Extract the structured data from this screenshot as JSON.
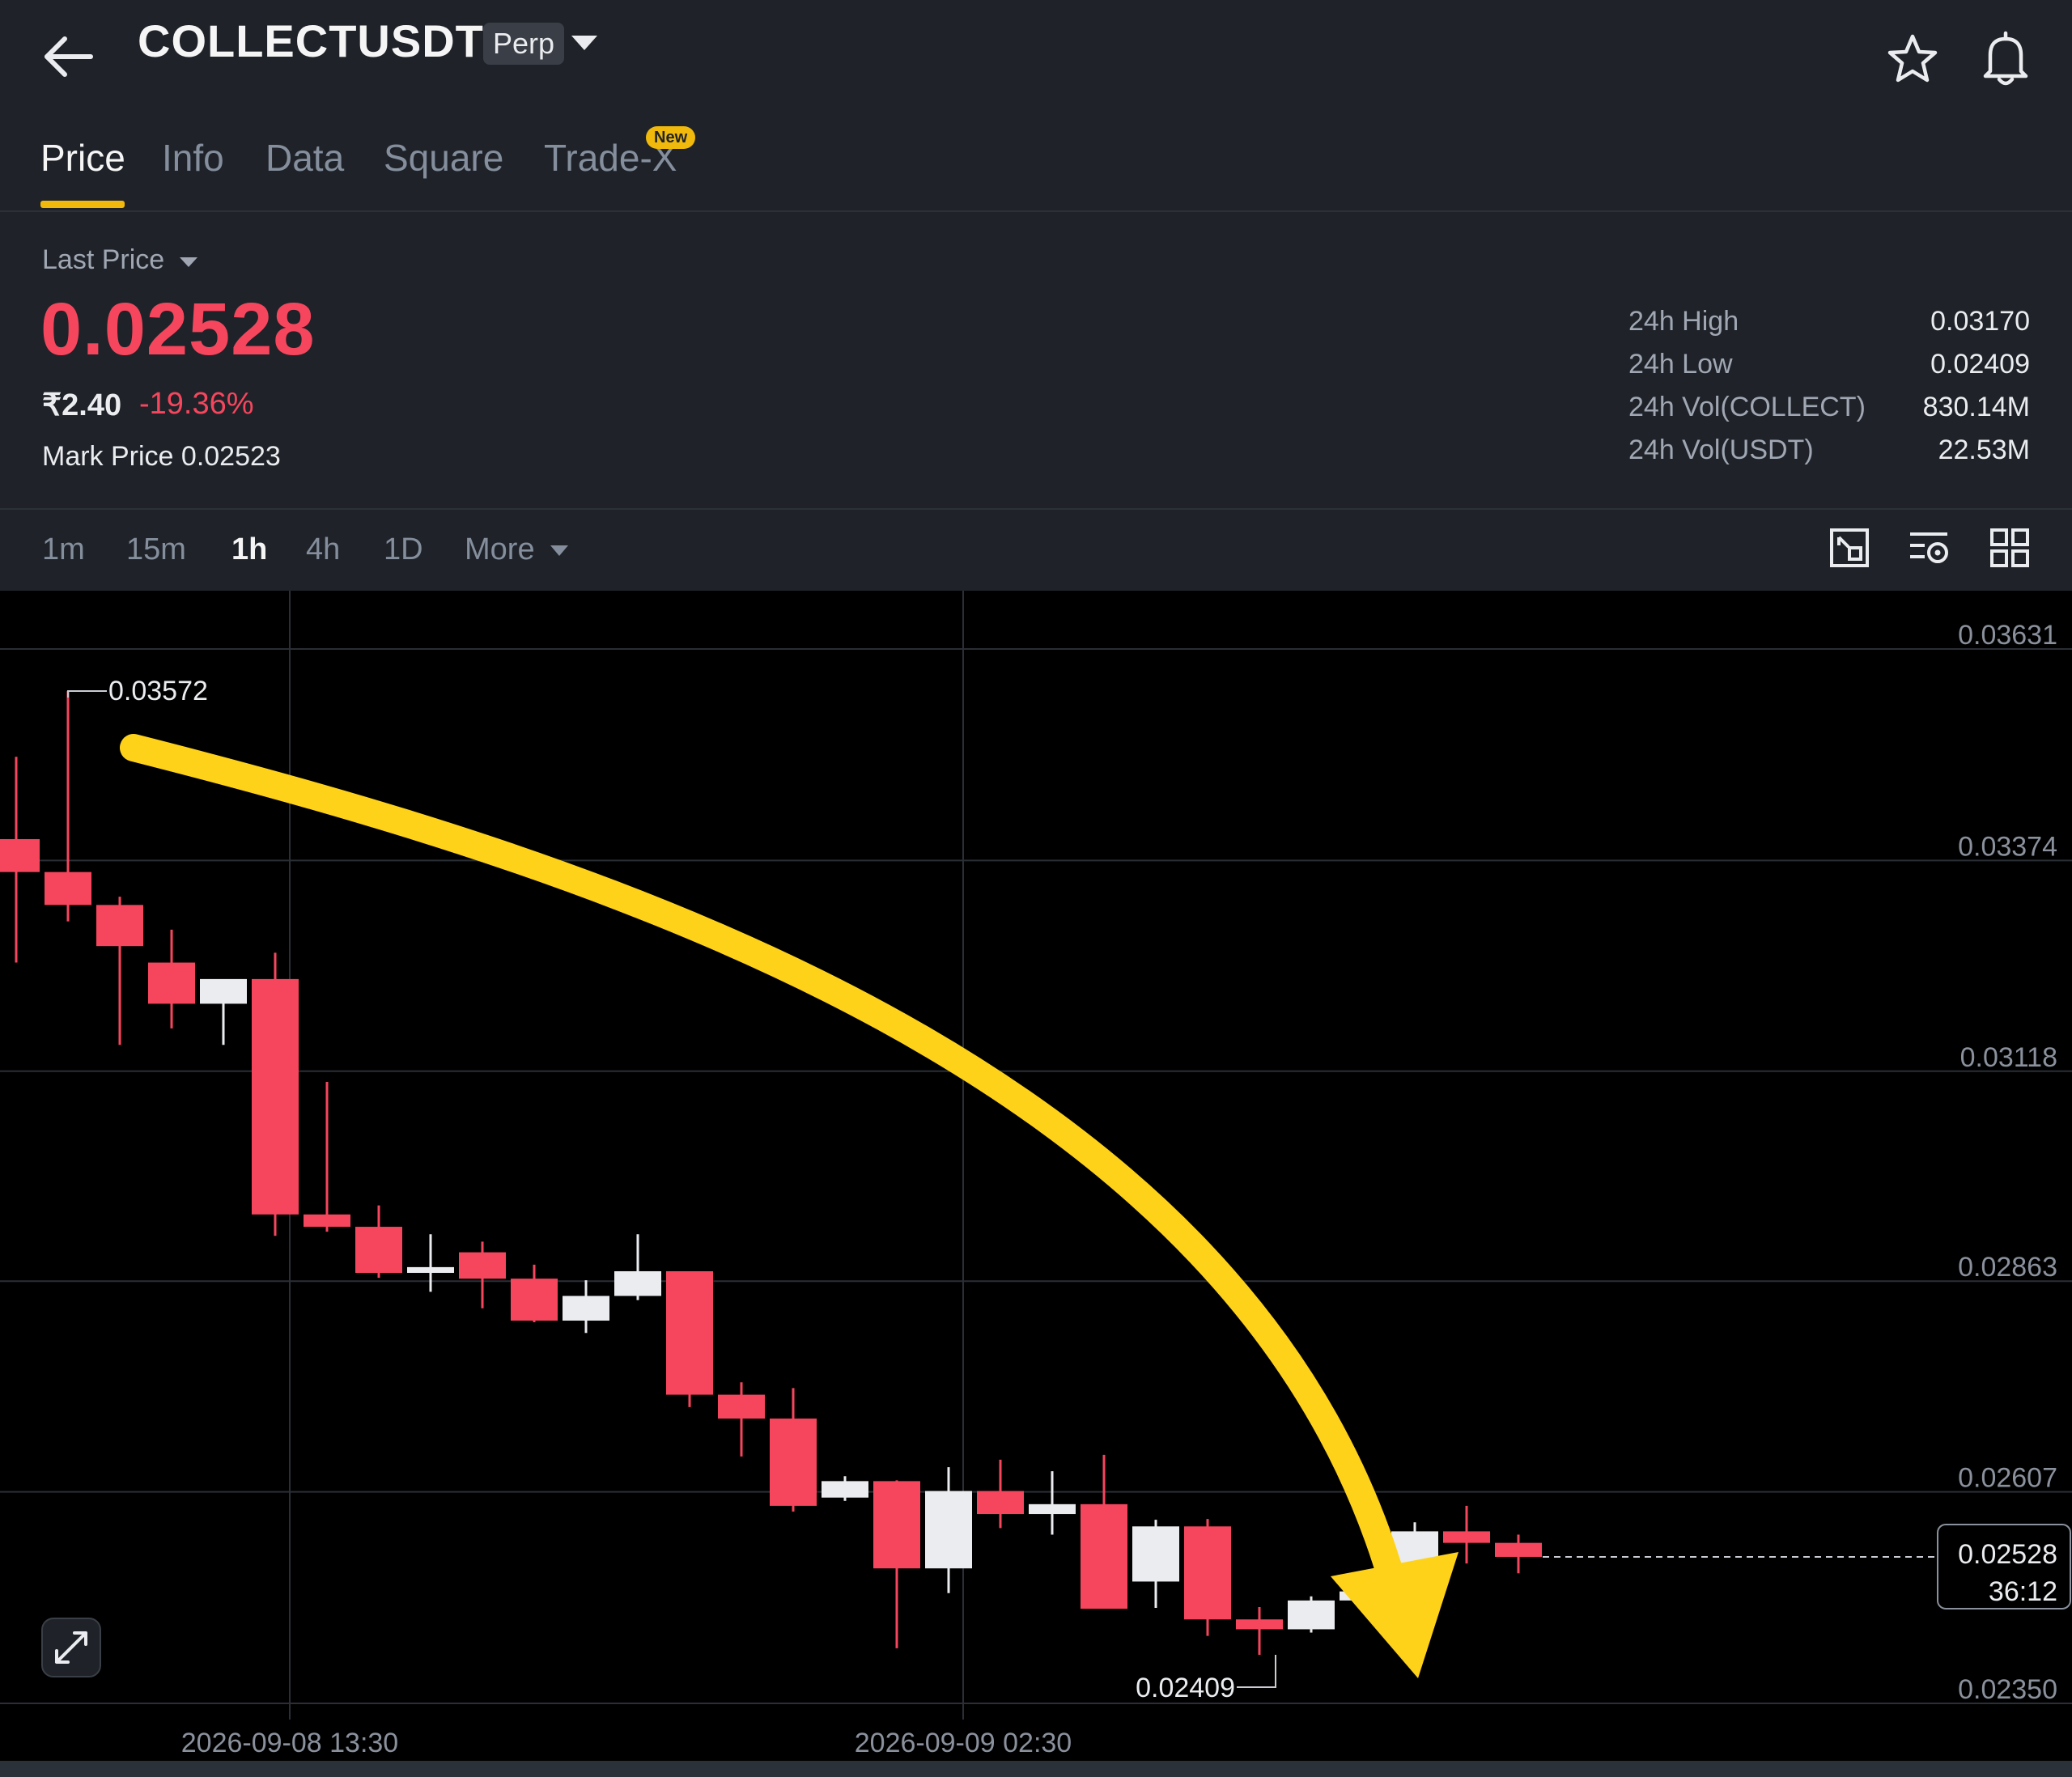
{
  "header": {
    "symbol": "COLLECTUSDT",
    "contract_badge": "Perp",
    "icons": [
      "back-arrow-icon",
      "caret-down-icon",
      "star-icon",
      "bell-icon"
    ]
  },
  "tabs": [
    {
      "label": "Price",
      "active": true
    },
    {
      "label": "Info",
      "active": false
    },
    {
      "label": "Data",
      "active": false
    },
    {
      "label": "Square",
      "active": false
    },
    {
      "label": "Trade-X",
      "active": false,
      "badge": "New"
    }
  ],
  "price_panel": {
    "last_price_label": "Last Price",
    "last_price": "0.02528",
    "fiat_value": "₹2.40",
    "change_percent": "-19.36%",
    "mark_price_label": "Mark Price",
    "mark_price": "0.02523"
  },
  "stats": [
    {
      "label": "24h High",
      "value": "0.03170"
    },
    {
      "label": "24h Low",
      "value": "0.02409"
    },
    {
      "label": "24h Vol(COLLECT)",
      "value": "830.14M"
    },
    {
      "label": "24h Vol(USDT)",
      "value": "22.53M"
    }
  ],
  "intervals": [
    {
      "label": "1m",
      "active": false
    },
    {
      "label": "15m",
      "active": false
    },
    {
      "label": "1h",
      "active": true
    },
    {
      "label": "4h",
      "active": false
    },
    {
      "label": "1D",
      "active": false
    },
    {
      "label": "More",
      "active": false
    }
  ],
  "chart_tools": [
    "fullscreen-chart-icon",
    "indicator-settings-icon",
    "layout-grid-icon"
  ],
  "colors": {
    "up": "#eaecef",
    "down": "#f6465d",
    "accent": "#f0b90b",
    "annotation_arrow": "#ffd21a",
    "background": "#000000",
    "panel": "#1f2329"
  },
  "chart_data": {
    "type": "candlestick",
    "interval": "1h",
    "y_ticks": [
      "0.03631",
      "0.03374",
      "0.03118",
      "0.02863",
      "0.02607",
      "0.02350"
    ],
    "ylim": [
      0.0235,
      0.03631
    ],
    "x_ticks": [
      "2026-09-08 13:30",
      "2026-09-09 02:30"
    ],
    "x_tick_candle_index": [
      5,
      18
    ],
    "high_marker": {
      "label": "0.03572",
      "value": 0.03572
    },
    "low_marker": {
      "label": "0.02409",
      "value": 0.02409
    },
    "current_price": {
      "label": "0.02528",
      "value": 0.02528,
      "countdown": "36:12"
    },
    "annotation": "curved arrow pointing down from top-left to bottom-right",
    "candles": [
      {
        "o": 0.034,
        "h": 0.035,
        "l": 0.0325,
        "c": 0.0336
      },
      {
        "o": 0.0336,
        "h": 0.0358,
        "l": 0.033,
        "c": 0.0332
      },
      {
        "o": 0.0332,
        "h": 0.0333,
        "l": 0.0315,
        "c": 0.0327
      },
      {
        "o": 0.0325,
        "h": 0.0329,
        "l": 0.0317,
        "c": 0.032
      },
      {
        "o": 0.032,
        "h": 0.0322,
        "l": 0.0315,
        "c": 0.0323
      },
      {
        "o": 0.0323,
        "h": 0.03262,
        "l": 0.02918,
        "c": 0.02944
      },
      {
        "o": 0.02944,
        "h": 0.03105,
        "l": 0.02923,
        "c": 0.02929
      },
      {
        "o": 0.02929,
        "h": 0.02955,
        "l": 0.02867,
        "c": 0.02873
      },
      {
        "o": 0.02873,
        "h": 0.0292,
        "l": 0.0285,
        "c": 0.0288
      },
      {
        "o": 0.02898,
        "h": 0.02911,
        "l": 0.0283,
        "c": 0.02866
      },
      {
        "o": 0.02866,
        "h": 0.02883,
        "l": 0.02813,
        "c": 0.02815
      },
      {
        "o": 0.02815,
        "h": 0.02864,
        "l": 0.028,
        "c": 0.02845
      },
      {
        "o": 0.02845,
        "h": 0.0292,
        "l": 0.0284,
        "c": 0.02875
      },
      {
        "o": 0.02875,
        "h": 0.02875,
        "l": 0.0271,
        "c": 0.02725
      },
      {
        "o": 0.02725,
        "h": 0.0274,
        "l": 0.0265,
        "c": 0.02696
      },
      {
        "o": 0.02696,
        "h": 0.02733,
        "l": 0.02583,
        "c": 0.0259
      },
      {
        "o": 0.026,
        "h": 0.02626,
        "l": 0.02596,
        "c": 0.0262
      },
      {
        "o": 0.0262,
        "h": 0.02621,
        "l": 0.02417,
        "c": 0.02514
      },
      {
        "o": 0.02514,
        "h": 0.02637,
        "l": 0.02484,
        "c": 0.02608
      },
      {
        "o": 0.02608,
        "h": 0.02646,
        "l": 0.02563,
        "c": 0.0258
      },
      {
        "o": 0.0258,
        "h": 0.02632,
        "l": 0.02555,
        "c": 0.02592
      },
      {
        "o": 0.02592,
        "h": 0.02652,
        "l": 0.02466,
        "c": 0.02465
      },
      {
        "o": 0.02498,
        "h": 0.02573,
        "l": 0.02466,
        "c": 0.02565
      },
      {
        "o": 0.02565,
        "h": 0.02574,
        "l": 0.02432,
        "c": 0.02452
      },
      {
        "o": 0.02452,
        "h": 0.02467,
        "l": 0.02409,
        "c": 0.0244
      },
      {
        "o": 0.0244,
        "h": 0.0248,
        "l": 0.02436,
        "c": 0.02475
      },
      {
        "o": 0.02475,
        "h": 0.0251,
        "l": 0.02465,
        "c": 0.02486
      },
      {
        "o": 0.02486,
        "h": 0.0257,
        "l": 0.0247,
        "c": 0.02559
      },
      {
        "o": 0.02559,
        "h": 0.0259,
        "l": 0.0252,
        "c": 0.02545
      },
      {
        "o": 0.02545,
        "h": 0.02555,
        "l": 0.02508,
        "c": 0.02528
      }
    ]
  }
}
